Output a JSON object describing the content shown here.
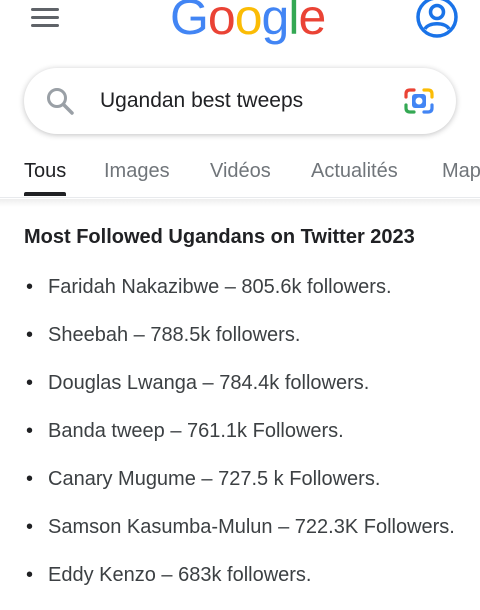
{
  "header": {
    "logo_text": "Google",
    "logo_colors": [
      "#4285f4",
      "#ea4335",
      "#fbbc05",
      "#4285f4",
      "#34a853",
      "#ea4335"
    ],
    "menu_icon": "hamburger-menu-icon",
    "account_icon": "account-circle-icon"
  },
  "search": {
    "query": "Ugandan best tweeps",
    "search_icon": "search-icon",
    "lens_icon": "google-lens-icon"
  },
  "tabs": [
    {
      "label": "Tous",
      "active": true
    },
    {
      "label": "Images",
      "active": false
    },
    {
      "label": "Vidéos",
      "active": false
    },
    {
      "label": "Actualités",
      "active": false
    },
    {
      "label": "Maps",
      "active": false
    }
  ],
  "result": {
    "title": "Most Followed Ugandans on Twitter 2023",
    "items": [
      "Faridah Nakazibwe – 805.6k followers.",
      "Sheebah – 788.5k followers.",
      "Douglas Lwanga – 784.4k followers.",
      "Banda tweep – 761.1k Followers.",
      "Canary Mugume – 727.5 k Followers.",
      "Samson Kasumba-Mulun – 722.3K Followers.",
      "Eddy Kenzo – 683k followers."
    ]
  },
  "colors": {
    "accent": "#1a73e8",
    "text": "#202124",
    "muted": "#70757a"
  }
}
